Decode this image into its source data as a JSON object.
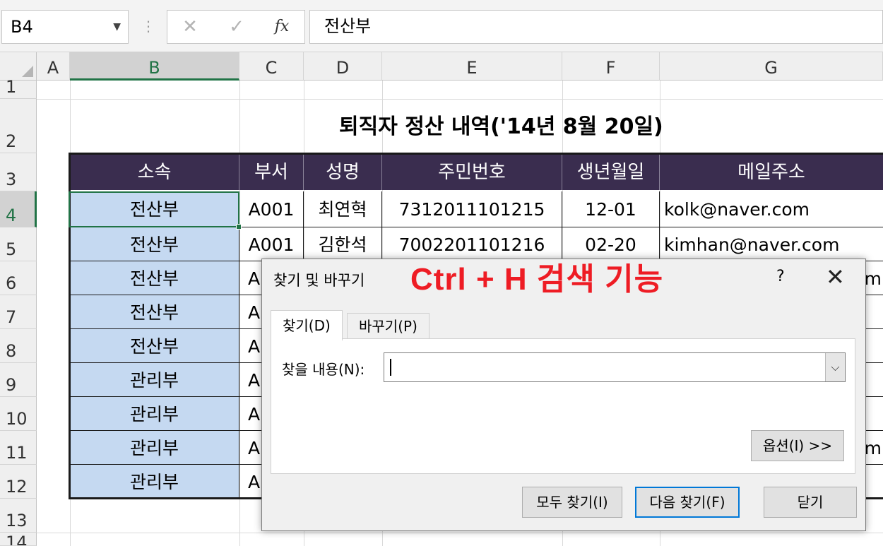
{
  "formula_bar": {
    "name_box": "B4",
    "cancel_icon": "✕",
    "enter_icon": "✓",
    "fx_label": "fx",
    "content": "전산부"
  },
  "columns": [
    "A",
    "B",
    "C",
    "D",
    "E",
    "F",
    "G"
  ],
  "rows": [
    "1",
    "2",
    "3",
    "4",
    "5",
    "6",
    "7",
    "8",
    "9",
    "10",
    "11",
    "12",
    "13",
    "14"
  ],
  "sheet_title": "퇴직자 정산 내역('14년 8월 20일)",
  "table_headers": [
    "소속",
    "부서",
    "성명",
    "주민번호",
    "생년월일",
    "메일주소"
  ],
  "table_rows": [
    [
      "전산부",
      "A001",
      "최연혁",
      "7312011101215",
      "12-01",
      "kolk@naver.com"
    ],
    [
      "전산부",
      "A001",
      "김한석",
      "7002201101216",
      "02-20",
      "kimhan@naver.com"
    ],
    [
      "전산부",
      "A",
      "",
      "",
      "",
      "m"
    ],
    [
      "전산부",
      "A",
      "",
      "",
      "",
      ""
    ],
    [
      "전산부",
      "A",
      "",
      "",
      "",
      ""
    ],
    [
      "관리부",
      "A",
      "",
      "",
      "",
      ""
    ],
    [
      "관리부",
      "A",
      "",
      "",
      "",
      ""
    ],
    [
      "관리부",
      "A",
      "",
      "",
      "",
      "m"
    ],
    [
      "관리부",
      "A",
      "",
      "",
      "",
      ""
    ]
  ],
  "dialog": {
    "title": "찾기 및 바꾸기",
    "annotation": "Ctrl + H 검색 기능",
    "help": "?",
    "close_icon": "✕",
    "tabs": [
      "찾기(D)",
      "바꾸기(P)"
    ],
    "find_label": "찾을 내용(N):",
    "find_value": "",
    "options_button": "옵션(I) >>",
    "find_all_button": "모두 찾기(I)",
    "find_next_button": "다음 찾기(F)",
    "close_button": "닫기"
  },
  "colors": {
    "header_bg": "#3a2d4f",
    "selected_fill": "#c5d9f1",
    "excel_green": "#217346",
    "annotation_red": "#ee1c24"
  }
}
